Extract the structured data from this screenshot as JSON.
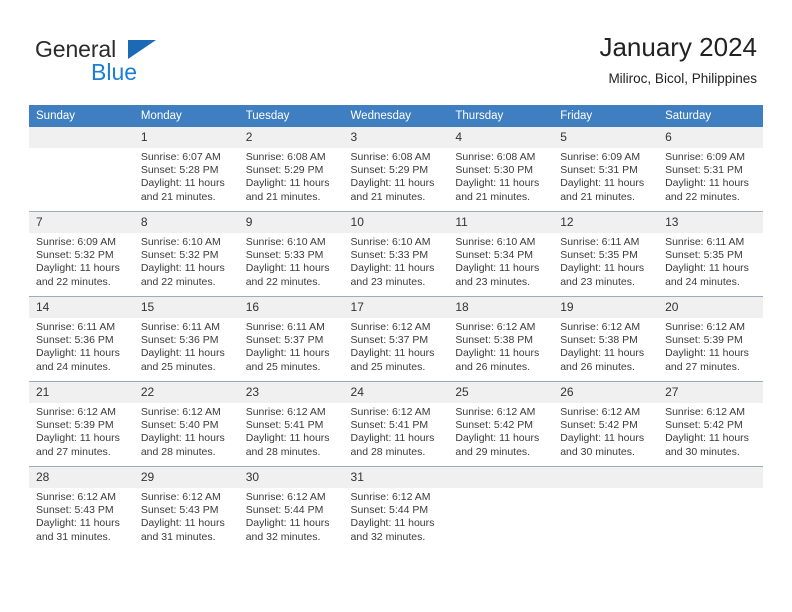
{
  "brand": {
    "word_one": "General",
    "word_two": "Blue",
    "triangle_color": "#1a6ab5",
    "blue_color": "#1a7fd4"
  },
  "header": {
    "title": "January 2024",
    "subtitle": "Miliroc, Bicol, Philippines",
    "header_bg": "#3f7fc1",
    "daynum_bg": "#f0f0f0"
  },
  "weekday_headers": [
    "Sunday",
    "Monday",
    "Tuesday",
    "Wednesday",
    "Thursday",
    "Friday",
    "Saturday"
  ],
  "weeks": [
    {
      "days": [
        {
          "num": "",
          "sunrise": "",
          "sunset": "",
          "daylight_line1": "",
          "daylight_line2": ""
        },
        {
          "num": "1",
          "sunrise": "Sunrise: 6:07 AM",
          "sunset": "Sunset: 5:28 PM",
          "daylight_line1": "Daylight: 11 hours",
          "daylight_line2": "and 21 minutes."
        },
        {
          "num": "2",
          "sunrise": "Sunrise: 6:08 AM",
          "sunset": "Sunset: 5:29 PM",
          "daylight_line1": "Daylight: 11 hours",
          "daylight_line2": "and 21 minutes."
        },
        {
          "num": "3",
          "sunrise": "Sunrise: 6:08 AM",
          "sunset": "Sunset: 5:29 PM",
          "daylight_line1": "Daylight: 11 hours",
          "daylight_line2": "and 21 minutes."
        },
        {
          "num": "4",
          "sunrise": "Sunrise: 6:08 AM",
          "sunset": "Sunset: 5:30 PM",
          "daylight_line1": "Daylight: 11 hours",
          "daylight_line2": "and 21 minutes."
        },
        {
          "num": "5",
          "sunrise": "Sunrise: 6:09 AM",
          "sunset": "Sunset: 5:31 PM",
          "daylight_line1": "Daylight: 11 hours",
          "daylight_line2": "and 21 minutes."
        },
        {
          "num": "6",
          "sunrise": "Sunrise: 6:09 AM",
          "sunset": "Sunset: 5:31 PM",
          "daylight_line1": "Daylight: 11 hours",
          "daylight_line2": "and 22 minutes."
        }
      ]
    },
    {
      "days": [
        {
          "num": "7",
          "sunrise": "Sunrise: 6:09 AM",
          "sunset": "Sunset: 5:32 PM",
          "daylight_line1": "Daylight: 11 hours",
          "daylight_line2": "and 22 minutes."
        },
        {
          "num": "8",
          "sunrise": "Sunrise: 6:10 AM",
          "sunset": "Sunset: 5:32 PM",
          "daylight_line1": "Daylight: 11 hours",
          "daylight_line2": "and 22 minutes."
        },
        {
          "num": "9",
          "sunrise": "Sunrise: 6:10 AM",
          "sunset": "Sunset: 5:33 PM",
          "daylight_line1": "Daylight: 11 hours",
          "daylight_line2": "and 22 minutes."
        },
        {
          "num": "10",
          "sunrise": "Sunrise: 6:10 AM",
          "sunset": "Sunset: 5:33 PM",
          "daylight_line1": "Daylight: 11 hours",
          "daylight_line2": "and 23 minutes."
        },
        {
          "num": "11",
          "sunrise": "Sunrise: 6:10 AM",
          "sunset": "Sunset: 5:34 PM",
          "daylight_line1": "Daylight: 11 hours",
          "daylight_line2": "and 23 minutes."
        },
        {
          "num": "12",
          "sunrise": "Sunrise: 6:11 AM",
          "sunset": "Sunset: 5:35 PM",
          "daylight_line1": "Daylight: 11 hours",
          "daylight_line2": "and 23 minutes."
        },
        {
          "num": "13",
          "sunrise": "Sunrise: 6:11 AM",
          "sunset": "Sunset: 5:35 PM",
          "daylight_line1": "Daylight: 11 hours",
          "daylight_line2": "and 24 minutes."
        }
      ]
    },
    {
      "days": [
        {
          "num": "14",
          "sunrise": "Sunrise: 6:11 AM",
          "sunset": "Sunset: 5:36 PM",
          "daylight_line1": "Daylight: 11 hours",
          "daylight_line2": "and 24 minutes."
        },
        {
          "num": "15",
          "sunrise": "Sunrise: 6:11 AM",
          "sunset": "Sunset: 5:36 PM",
          "daylight_line1": "Daylight: 11 hours",
          "daylight_line2": "and 25 minutes."
        },
        {
          "num": "16",
          "sunrise": "Sunrise: 6:11 AM",
          "sunset": "Sunset: 5:37 PM",
          "daylight_line1": "Daylight: 11 hours",
          "daylight_line2": "and 25 minutes."
        },
        {
          "num": "17",
          "sunrise": "Sunrise: 6:12 AM",
          "sunset": "Sunset: 5:37 PM",
          "daylight_line1": "Daylight: 11 hours",
          "daylight_line2": "and 25 minutes."
        },
        {
          "num": "18",
          "sunrise": "Sunrise: 6:12 AM",
          "sunset": "Sunset: 5:38 PM",
          "daylight_line1": "Daylight: 11 hours",
          "daylight_line2": "and 26 minutes."
        },
        {
          "num": "19",
          "sunrise": "Sunrise: 6:12 AM",
          "sunset": "Sunset: 5:38 PM",
          "daylight_line1": "Daylight: 11 hours",
          "daylight_line2": "and 26 minutes."
        },
        {
          "num": "20",
          "sunrise": "Sunrise: 6:12 AM",
          "sunset": "Sunset: 5:39 PM",
          "daylight_line1": "Daylight: 11 hours",
          "daylight_line2": "and 27 minutes."
        }
      ]
    },
    {
      "days": [
        {
          "num": "21",
          "sunrise": "Sunrise: 6:12 AM",
          "sunset": "Sunset: 5:39 PM",
          "daylight_line1": "Daylight: 11 hours",
          "daylight_line2": "and 27 minutes."
        },
        {
          "num": "22",
          "sunrise": "Sunrise: 6:12 AM",
          "sunset": "Sunset: 5:40 PM",
          "daylight_line1": "Daylight: 11 hours",
          "daylight_line2": "and 28 minutes."
        },
        {
          "num": "23",
          "sunrise": "Sunrise: 6:12 AM",
          "sunset": "Sunset: 5:41 PM",
          "daylight_line1": "Daylight: 11 hours",
          "daylight_line2": "and 28 minutes."
        },
        {
          "num": "24",
          "sunrise": "Sunrise: 6:12 AM",
          "sunset": "Sunset: 5:41 PM",
          "daylight_line1": "Daylight: 11 hours",
          "daylight_line2": "and 28 minutes."
        },
        {
          "num": "25",
          "sunrise": "Sunrise: 6:12 AM",
          "sunset": "Sunset: 5:42 PM",
          "daylight_line1": "Daylight: 11 hours",
          "daylight_line2": "and 29 minutes."
        },
        {
          "num": "26",
          "sunrise": "Sunrise: 6:12 AM",
          "sunset": "Sunset: 5:42 PM",
          "daylight_line1": "Daylight: 11 hours",
          "daylight_line2": "and 30 minutes."
        },
        {
          "num": "27",
          "sunrise": "Sunrise: 6:12 AM",
          "sunset": "Sunset: 5:42 PM",
          "daylight_line1": "Daylight: 11 hours",
          "daylight_line2": "and 30 minutes."
        }
      ]
    },
    {
      "days": [
        {
          "num": "28",
          "sunrise": "Sunrise: 6:12 AM",
          "sunset": "Sunset: 5:43 PM",
          "daylight_line1": "Daylight: 11 hours",
          "daylight_line2": "and 31 minutes."
        },
        {
          "num": "29",
          "sunrise": "Sunrise: 6:12 AM",
          "sunset": "Sunset: 5:43 PM",
          "daylight_line1": "Daylight: 11 hours",
          "daylight_line2": "and 31 minutes."
        },
        {
          "num": "30",
          "sunrise": "Sunrise: 6:12 AM",
          "sunset": "Sunset: 5:44 PM",
          "daylight_line1": "Daylight: 11 hours",
          "daylight_line2": "and 32 minutes."
        },
        {
          "num": "31",
          "sunrise": "Sunrise: 6:12 AM",
          "sunset": "Sunset: 5:44 PM",
          "daylight_line1": "Daylight: 11 hours",
          "daylight_line2": "and 32 minutes."
        },
        {
          "num": "",
          "sunrise": "",
          "sunset": "",
          "daylight_line1": "",
          "daylight_line2": ""
        },
        {
          "num": "",
          "sunrise": "",
          "sunset": "",
          "daylight_line1": "",
          "daylight_line2": ""
        },
        {
          "num": "",
          "sunrise": "",
          "sunset": "",
          "daylight_line1": "",
          "daylight_line2": ""
        }
      ]
    }
  ]
}
